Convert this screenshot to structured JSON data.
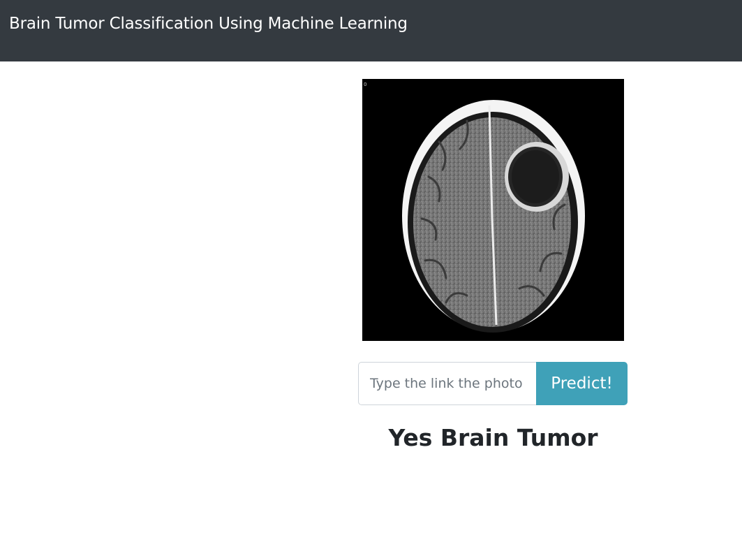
{
  "navbar": {
    "title": "Brain Tumor Classification Using Machine Learning"
  },
  "scan_image": {
    "icon": "brain-ct-scan",
    "corner_marker": "0"
  },
  "form": {
    "link_input": {
      "value": "",
      "placeholder": "Type the link the photo"
    },
    "predict_label": "Predict!"
  },
  "result": {
    "text": "Yes Brain Tumor"
  },
  "colors": {
    "navbar_bg": "#343a40",
    "button_bg": "#3fa1b8",
    "result_text": "#212529"
  }
}
